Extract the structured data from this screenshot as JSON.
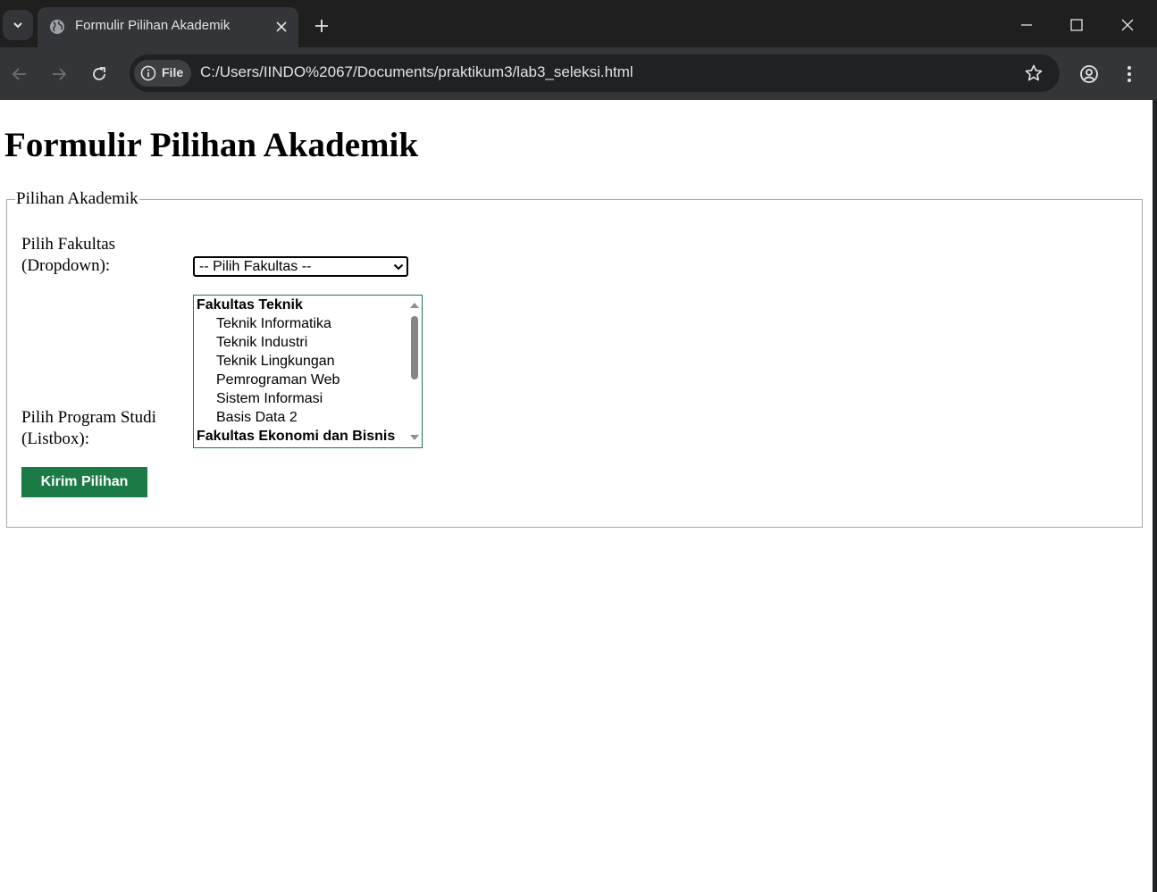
{
  "browser": {
    "tab_title": "Formulir Pilihan Akademik",
    "chip_label": "File",
    "url": "C:/Users/IINDO%2067/Documents/praktikum3/lab3_seleksi.html",
    "icons": [
      "chevron-down-icon",
      "globe-icon",
      "close-icon",
      "plus-icon",
      "minimize-icon",
      "maximize-icon",
      "close-icon",
      "back-arrow-icon",
      "forward-arrow-icon",
      "reload-icon",
      "info-icon",
      "star-icon",
      "profile-icon",
      "more-vert-icon"
    ]
  },
  "page": {
    "title": "Formulir Pilihan Akademik",
    "fieldset_legend": "Pilihan Akademik",
    "faculty_label_line1": "Pilih Fakultas",
    "faculty_label_line2": "(Dropdown):",
    "faculty_select_value": "-- Pilih Fakultas --",
    "program_label_line1": "Pilih Program Studi",
    "program_label_line2": "(Listbox):",
    "listbox_items": [
      {
        "type": "group",
        "text": "Fakultas Teknik"
      },
      {
        "type": "option",
        "text": "Teknik Informatika"
      },
      {
        "type": "option",
        "text": "Teknik Industri"
      },
      {
        "type": "option",
        "text": "Teknik Lingkungan"
      },
      {
        "type": "option",
        "text": "Pemrograman Web"
      },
      {
        "type": "option",
        "text": "Sistem Informasi"
      },
      {
        "type": "option",
        "text": "Basis Data 2"
      },
      {
        "type": "group",
        "text": "Fakultas Ekonomi dan Bisnis"
      }
    ],
    "submit_label": "Kirim Pilihan",
    "colors": {
      "button": "#1b7a45",
      "listbox_border": "#1c7b46"
    }
  }
}
